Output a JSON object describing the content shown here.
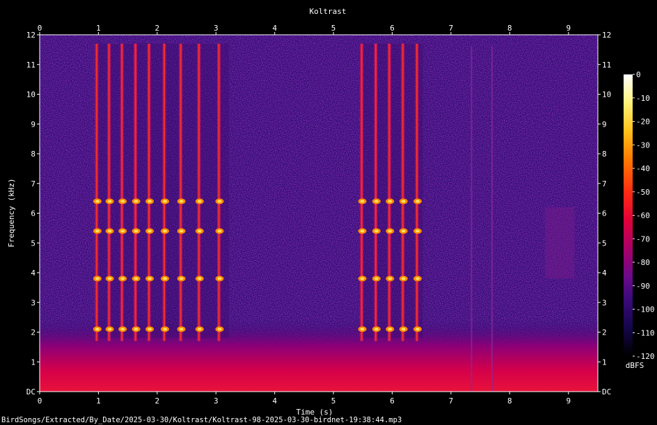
{
  "chart_data": {
    "type": "heatmap",
    "title": "Koltrast",
    "xlabel": "Time (s)",
    "ylabel": "Frequency (kHz)",
    "xlim": [
      0,
      9.5
    ],
    "ylim": [
      0,
      12
    ],
    "x_ticks": [
      {
        "value": 0,
        "label": "0"
      },
      {
        "value": 1,
        "label": "1"
      },
      {
        "value": 2,
        "label": "2"
      },
      {
        "value": 3,
        "label": "3"
      },
      {
        "value": 4,
        "label": "4"
      },
      {
        "value": 5,
        "label": "5"
      },
      {
        "value": 6,
        "label": "6"
      },
      {
        "value": 7,
        "label": "7"
      },
      {
        "value": 8,
        "label": "8"
      },
      {
        "value": 9,
        "label": "9"
      }
    ],
    "y_ticks": [
      {
        "value": 0,
        "label": "DC"
      },
      {
        "value": 1,
        "label": "1"
      },
      {
        "value": 2,
        "label": "2"
      },
      {
        "value": 3,
        "label": "3"
      },
      {
        "value": 4,
        "label": "4"
      },
      {
        "value": 5,
        "label": "5"
      },
      {
        "value": 6,
        "label": "6"
      },
      {
        "value": 7,
        "label": "7"
      },
      {
        "value": 8,
        "label": "8"
      },
      {
        "value": 9,
        "label": "9"
      },
      {
        "value": 10,
        "label": "10"
      },
      {
        "value": 11,
        "label": "11"
      },
      {
        "value": 12,
        "label": "12"
      }
    ],
    "colorbar": {
      "unit": "dBFS",
      "range": [
        -120,
        0
      ],
      "ticks": [
        {
          "value": 0,
          "label": "0"
        },
        {
          "value": -10,
          "label": "-10"
        },
        {
          "value": -20,
          "label": "-20"
        },
        {
          "value": -30,
          "label": "-30"
        },
        {
          "value": -40,
          "label": "-40"
        },
        {
          "value": -50,
          "label": "-50"
        },
        {
          "value": -60,
          "label": "-60"
        },
        {
          "value": -70,
          "label": "-70"
        },
        {
          "value": -80,
          "label": "-80"
        },
        {
          "value": -90,
          "label": "-90"
        },
        {
          "value": -100,
          "label": "-100"
        },
        {
          "value": -110,
          "label": "-110"
        },
        {
          "value": -120,
          "label": "-120"
        }
      ],
      "colormap": [
        "#ffffff",
        "#fff27a",
        "#ffc21a",
        "#ff7a00",
        "#ff2a12",
        "#e0003a",
        "#a8006a",
        "#6a0a8a",
        "#3a0a7a",
        "#14064a",
        "#000000"
      ]
    },
    "background_noise_level_dbfs": -92,
    "low_frequency_noise": {
      "freq_max_khz": 1.8,
      "level_dbfs": -55
    },
    "phrases": [
      {
        "start_s": 0.95,
        "end_s": 3.15,
        "note_times_s": [
          0.97,
          1.18,
          1.4,
          1.63,
          1.86,
          2.12,
          2.4,
          2.71,
          3.05
        ]
      },
      {
        "start_s": 5.45,
        "end_s": 6.45,
        "note_times_s": [
          5.48,
          5.72,
          5.95,
          6.18,
          6.42
        ]
      }
    ],
    "harmonic_bands_khz": [
      2.1,
      3.8,
      5.4,
      6.4
    ],
    "vertical_lines_s": [
      7.35,
      7.7
    ],
    "faint_patch": {
      "t_start_s": 8.6,
      "t_end_s": 9.1,
      "f_low_khz": 3.8,
      "f_high_khz": 6.2
    }
  },
  "footer": {
    "file_path": "BirdSongs/Extracted/By_Date/2025-03-30/Koltrast/Koltrast-98-2025-03-30-birdnet-19:38:44.mp3"
  }
}
